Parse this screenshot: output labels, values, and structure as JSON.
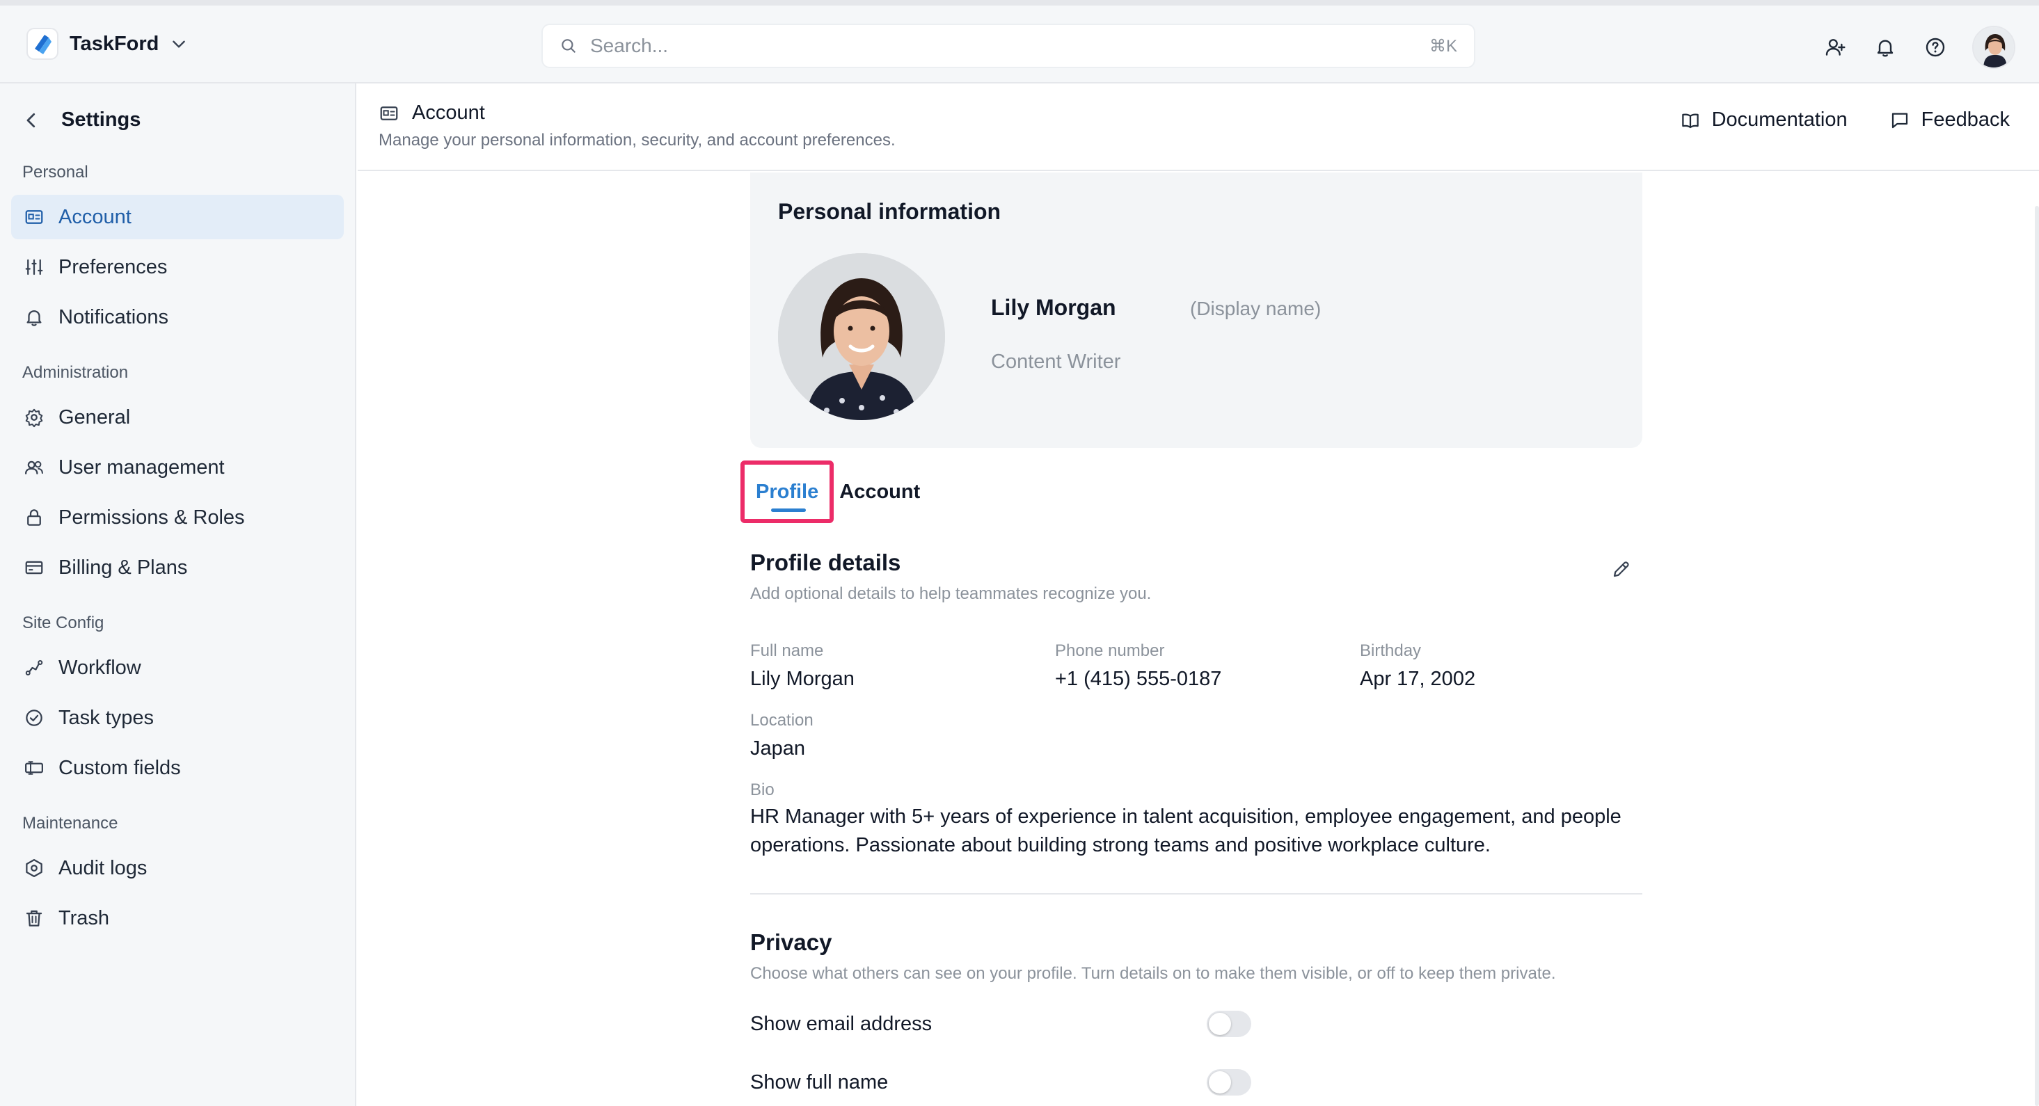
{
  "app": {
    "name": "TaskFord"
  },
  "search": {
    "placeholder": "Search...",
    "shortcut": "⌘K"
  },
  "icons": {
    "brand": "taskford-logo",
    "top": [
      "add-user-icon",
      "bell-icon",
      "help-icon"
    ]
  },
  "colors": {
    "accent": "#2b7fd0",
    "active_bg": "#e3edf8",
    "highlight": "#ec2c68"
  },
  "sidebar": {
    "title": "Settings",
    "groups": {
      "personal": "Personal",
      "administration": "Administration",
      "site_config": "Site Config",
      "maintenance": "Maintenance"
    },
    "items": {
      "account": "Account",
      "preferences": "Preferences",
      "notifications": "Notifications",
      "general": "General",
      "user_management": "User management",
      "permissions": "Permissions & Roles",
      "billing": "Billing & Plans",
      "workflow": "Workflow",
      "task_types": "Task types",
      "custom_fields": "Custom fields",
      "audit_logs": "Audit logs",
      "trash": "Trash"
    },
    "active": "account"
  },
  "header": {
    "title": "Account",
    "subtitle": "Manage your personal information, security, and account preferences.",
    "documentation": "Documentation",
    "feedback": "Feedback"
  },
  "personal_info": {
    "title": "Personal information",
    "name": "Lily Morgan",
    "display_name_hint": "(Display name)",
    "role": "Content Writer"
  },
  "tabs": {
    "profile": "Profile",
    "account": "Account",
    "active": "profile"
  },
  "profile_details": {
    "title": "Profile details",
    "subtitle": "Add optional details to help teammates recognize you.",
    "full_name_label": "Full name",
    "full_name": "Lily Morgan",
    "phone_label": "Phone number",
    "phone": "+1 (415) 555-0187",
    "birthday_label": "Birthday",
    "birthday": "Apr 17, 2002",
    "location_label": "Location",
    "location": "Japan",
    "bio_label": "Bio",
    "bio": "HR Manager with 5+ years of experience in talent acquisition, employee engagement, and people operations. Passionate about building strong teams and positive workplace culture."
  },
  "privacy": {
    "title": "Privacy",
    "subtitle": "Choose what others can see on your profile. Turn details on to make them visible, or off to keep them private.",
    "show_email": "Show email address",
    "show_email_on": false,
    "show_full_name": "Show full name",
    "show_full_name_on": false
  }
}
